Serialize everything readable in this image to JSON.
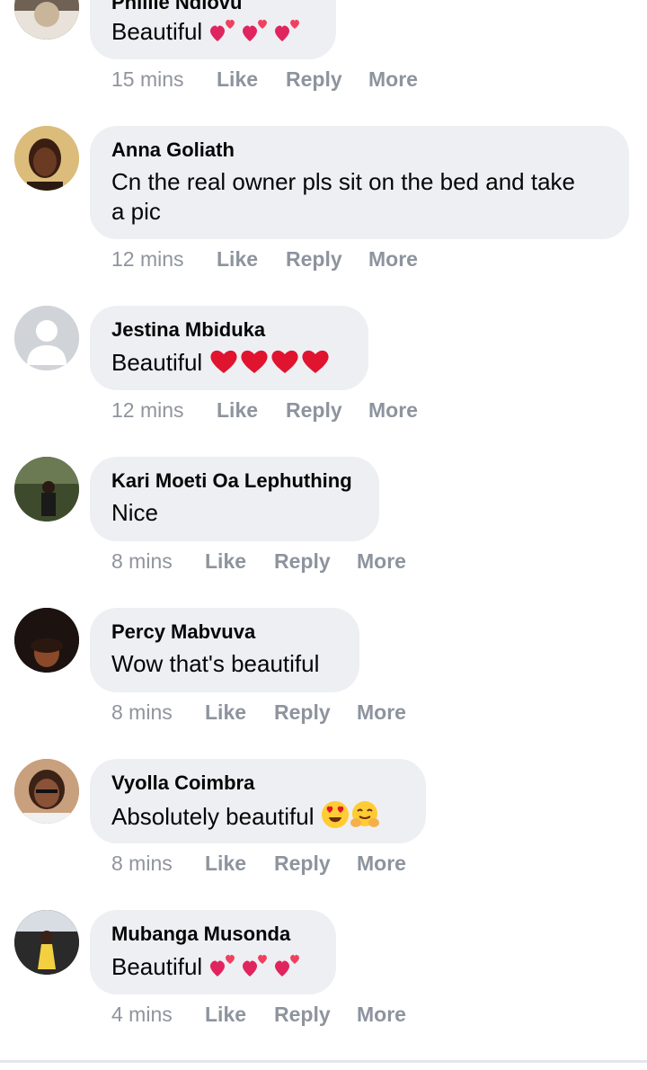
{
  "comments": [
    {
      "author": "Philile Ndlovu",
      "text": "Beautiful",
      "time": "15 mins",
      "emoji": [
        "two-hearts",
        "two-hearts",
        "two-hearts"
      ]
    },
    {
      "author": "Anna Goliath",
      "text": "Cn the real owner pls sit on the bed and take",
      "text2": "a pic",
      "time": "12 mins",
      "emoji": []
    },
    {
      "author": "Jestina Mbiduka",
      "text": "Beautiful",
      "time": "12 mins",
      "emoji": [
        "red-heart",
        "red-heart",
        "red-heart",
        "red-heart"
      ]
    },
    {
      "author": "Kari Moeti Oa Lephuthing",
      "text": "Nice",
      "time": "8 mins",
      "emoji": []
    },
    {
      "author": "Percy Mabvuva",
      "text": "Wow that's beautiful",
      "time": "8 mins",
      "emoji": []
    },
    {
      "author": "Vyolla Coimbra",
      "text": "Absolutely beautiful",
      "time": "8 mins",
      "emoji": [
        "heart-eyes",
        "hugging-face"
      ]
    },
    {
      "author": "Mubanga Musonda",
      "text": "Beautiful",
      "time": "4 mins",
      "emoji": [
        "two-hearts",
        "two-hearts",
        "two-hearts"
      ]
    }
  ],
  "actions": {
    "like": "Like",
    "reply": "Reply",
    "more": "More"
  },
  "colors": {
    "bubble": "#eeeff3",
    "meta": "#90949c",
    "heart": "#e0245e"
  }
}
